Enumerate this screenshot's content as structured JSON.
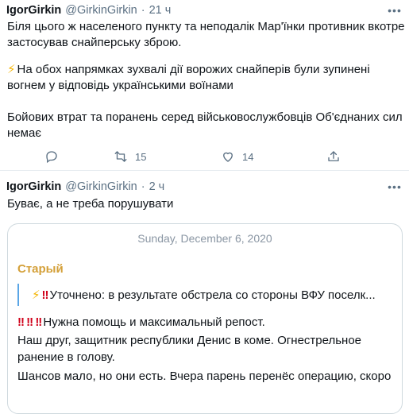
{
  "tweets": [
    {
      "author_name": "IgorGirkin",
      "author_handle": "@GirkinGirkin",
      "time": "21 ч",
      "lines": [
        "Біля цього ж населеного пункту та неподалік Мар'їнки противник вкотре",
        "застосував снайперську зброю.",
        "На обох напрямках зухвалі дії ворожих снайперів були зупинені",
        "вогнем у відповідь українськими воїнами",
        "Бойових втрат та поранень серед військовослужбовців Об'єднаних сил",
        "немає"
      ],
      "actions": {
        "reply_count": "",
        "retweet_count": "15",
        "like_count": "14"
      }
    },
    {
      "author_name": "IgorGirkin",
      "author_handle": "@GirkinGirkin",
      "time": "2 ч",
      "text": "Буває, а не треба порушувати",
      "quote": {
        "date": "Sunday, December 6, 2020",
        "sender": "Старый",
        "reply_text": "Уточнено: в результате обстрела со стороны ВФУ поселк...",
        "lines": [
          "Нужна помощь и максимальный репост.",
          "Наш друг, защитник республики Денис в коме. Огнестрельное",
          "ранение в голову.",
          "Шансов мало, но они есть. Вчера парень перенёс операцию, скоро"
        ]
      }
    }
  ],
  "icons": {
    "more": "more-horizontal-icon",
    "reply": "reply-icon",
    "retweet": "retweet-icon",
    "like": "heart-icon",
    "share": "share-icon",
    "bolt": "high-voltage-emoji",
    "exclamation": "double-exclamation-emoji"
  },
  "colors": {
    "text": "#0f1419",
    "secondary": "#5b7083",
    "quote_sender": "#d4a039",
    "reply_bar": "#5aa6e6",
    "emoji_red": "#d0021b",
    "bolt": "#f4b400"
  }
}
